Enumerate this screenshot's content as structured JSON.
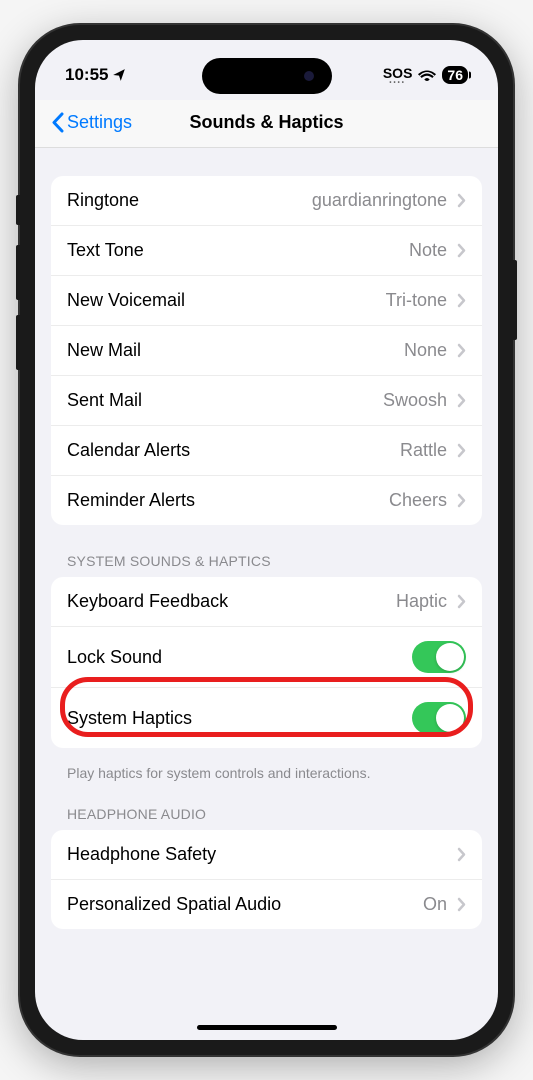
{
  "status": {
    "time": "10:55",
    "sos": "SOS",
    "battery": "76"
  },
  "nav": {
    "back": "Settings",
    "title": "Sounds & Haptics"
  },
  "sounds_group": [
    {
      "label": "Ringtone",
      "value": "guardianringtone"
    },
    {
      "label": "Text Tone",
      "value": "Note"
    },
    {
      "label": "New Voicemail",
      "value": "Tri-tone"
    },
    {
      "label": "New Mail",
      "value": "None"
    },
    {
      "label": "Sent Mail",
      "value": "Swoosh"
    },
    {
      "label": "Calendar Alerts",
      "value": "Rattle"
    },
    {
      "label": "Reminder Alerts",
      "value": "Cheers"
    }
  ],
  "system_sounds": {
    "header": "SYSTEM SOUNDS & HAPTICS",
    "keyboard_feedback": {
      "label": "Keyboard Feedback",
      "value": "Haptic"
    },
    "lock_sound": {
      "label": "Lock Sound",
      "on": true
    },
    "system_haptics": {
      "label": "System Haptics",
      "on": true
    },
    "footer": "Play haptics for system controls and interactions."
  },
  "headphone": {
    "header": "HEADPHONE AUDIO",
    "safety": {
      "label": "Headphone Safety",
      "value": ""
    },
    "spatial": {
      "label": "Personalized Spatial Audio",
      "value": "On"
    }
  }
}
